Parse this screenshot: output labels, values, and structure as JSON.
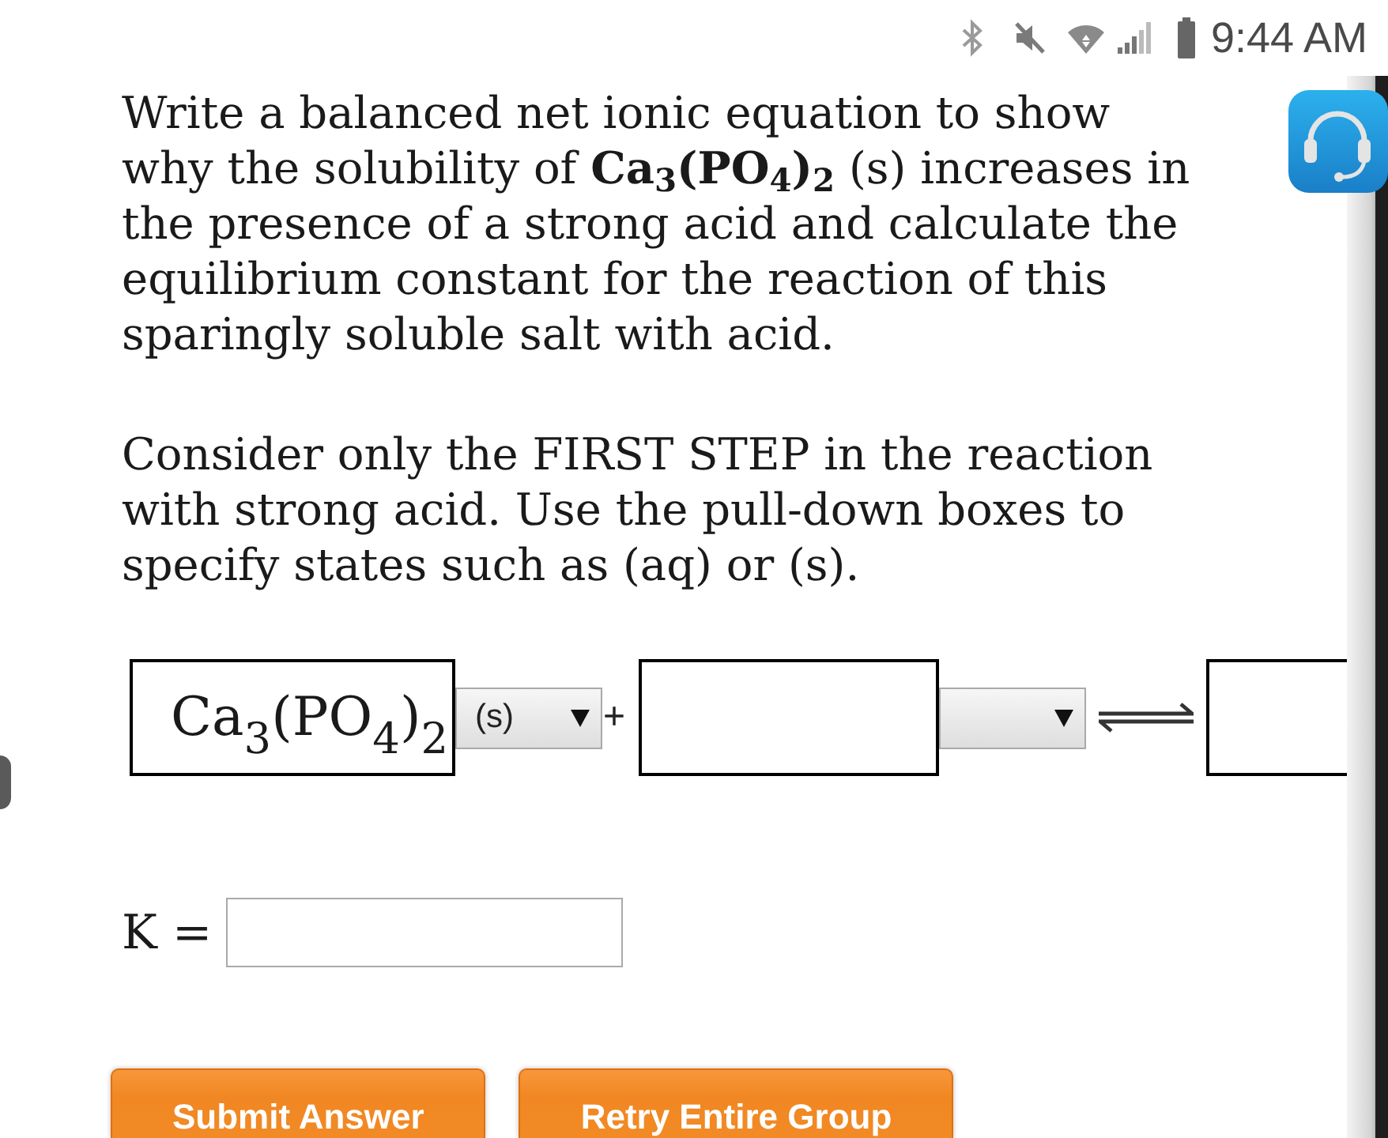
{
  "status_bar": {
    "time": "9:44 AM"
  },
  "question": {
    "paragraphs": [
      "Write a balanced net ionic equation to show why the solubility of **Ca$_{3}$(PO$_{4}$)$_{2}$** (s) increases in the presence of a strong acid and calculate the equilibrium constant for the reaction of this sparingly soluble salt with acid.",
      "Consider only the FIRST STEP in the reaction with strong acid. Use the pull-down boxes to specify states such as (aq) or (s)."
    ]
  },
  "equation": {
    "terms": [
      {
        "kind": "box",
        "value": "Ca$_{3}$(PO$_{4}$)$_{2}$"
      },
      {
        "kind": "select",
        "value": "(s)"
      },
      {
        "kind": "operator",
        "text": "+"
      },
      {
        "kind": "box"
      },
      {
        "kind": "select"
      },
      {
        "kind": "equilibrium"
      },
      {
        "kind": "box"
      }
    ]
  },
  "k_field": {
    "label": "K ="
  },
  "buttons": [
    {
      "label": "Submit Answer"
    },
    {
      "label": "Retry Entire Group"
    }
  ]
}
